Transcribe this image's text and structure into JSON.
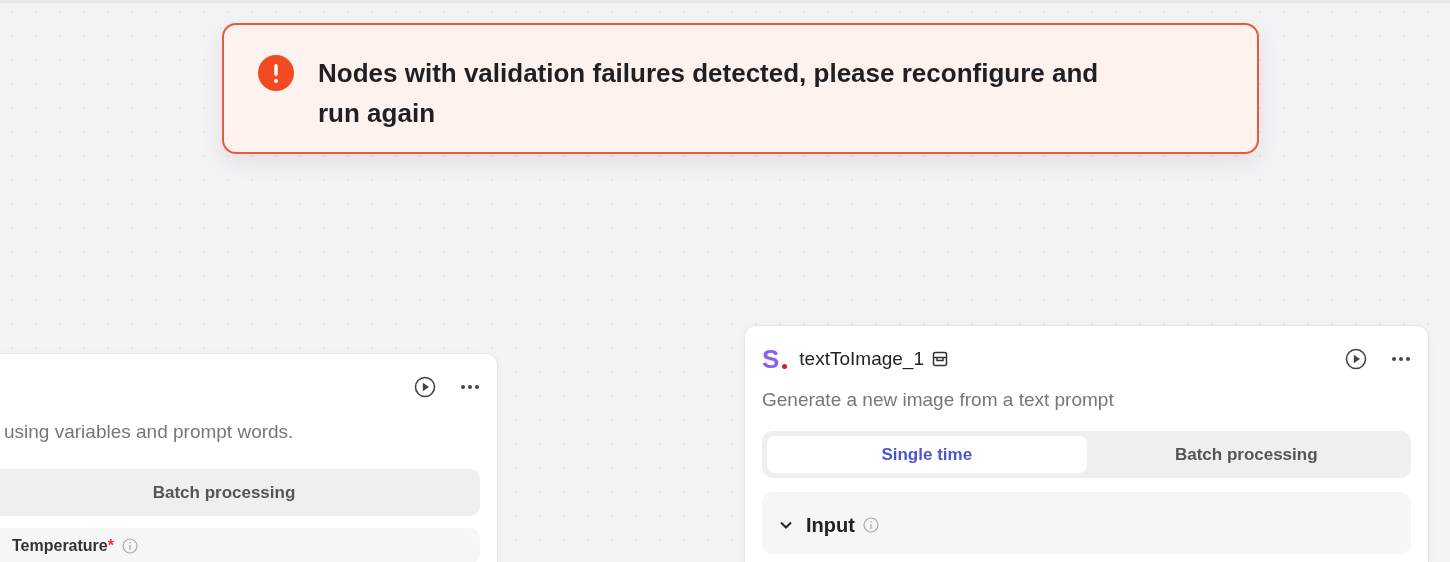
{
  "toast": {
    "kind": "error",
    "message": "Nodes with validation failures detected, please reconfigure and run again"
  },
  "nodes": [
    {
      "description": "using variables and prompt words.",
      "tabs": [
        {
          "label": "Batch processing",
          "selected": false
        }
      ],
      "section": {
        "kind": "field",
        "label": "Temperature",
        "required_mark": "*"
      }
    },
    {
      "logo_text": "S",
      "title": "textToImage_1",
      "description": "Generate a new image from a text prompt",
      "tabs": [
        {
          "label": "Single time",
          "selected": true
        },
        {
          "label": "Batch processing",
          "selected": false
        }
      ],
      "section": {
        "kind": "group",
        "label": "Input",
        "expanded": true
      }
    }
  ]
}
